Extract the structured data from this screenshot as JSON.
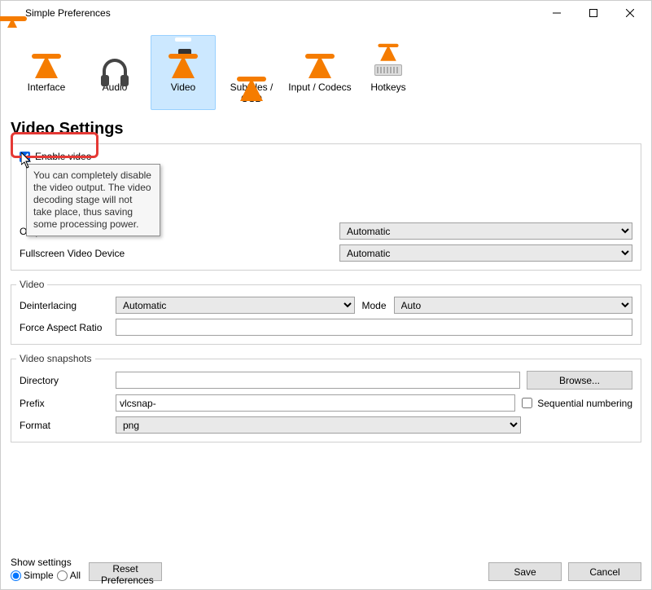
{
  "window": {
    "title": "Simple Preferences"
  },
  "categories": [
    {
      "label": "Interface"
    },
    {
      "label": "Audio"
    },
    {
      "label": "Video"
    },
    {
      "label": "Subtitles / OSD"
    },
    {
      "label": "Input / Codecs"
    },
    {
      "label": "Hotkeys"
    }
  ],
  "page_heading": "Video Settings",
  "enable_video": {
    "label": "Enable video",
    "checked": true
  },
  "tooltip_text": "You can completely disable the video output. The video decoding stage will not take place, thus saving some processing power.",
  "display": {
    "output_label": "Output",
    "output_value": "Automatic",
    "fs_device_label": "Fullscreen Video Device",
    "fs_device_value": "Automatic"
  },
  "video_group": {
    "legend": "Video",
    "deint_label": "Deinterlacing",
    "deint_value": "Automatic",
    "mode_label": "Mode",
    "mode_value": "Auto",
    "far_label": "Force Aspect Ratio",
    "far_value": ""
  },
  "snapshots": {
    "legend": "Video snapshots",
    "dir_label": "Directory",
    "dir_value": "",
    "browse_label": "Browse...",
    "prefix_label": "Prefix",
    "prefix_value": "vlcsnap-",
    "seq_label": "Sequential numbering",
    "seq_checked": false,
    "format_label": "Format",
    "format_value": "png"
  },
  "footer": {
    "show_label": "Show settings",
    "simple_label": "Simple",
    "all_label": "All",
    "reset_label": "Reset Preferences",
    "save_label": "Save",
    "cancel_label": "Cancel"
  }
}
